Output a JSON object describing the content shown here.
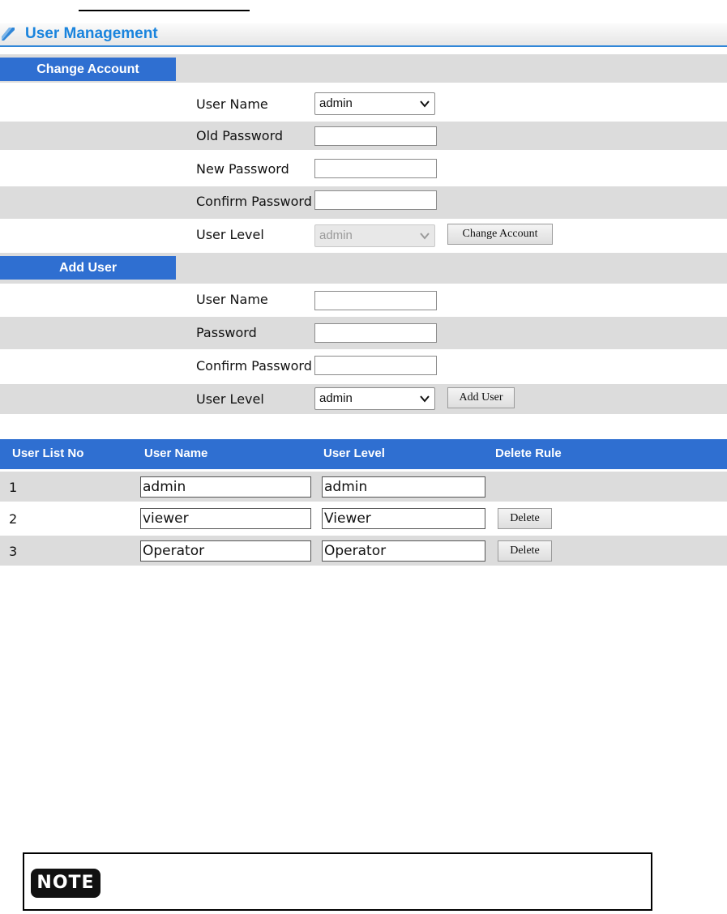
{
  "page": {
    "title": "User Management",
    "colors": {
      "accent": "#2f6fd1",
      "title": "#1a84dd",
      "row_gray": "#dcdcdc"
    }
  },
  "change_account": {
    "header": "Change Account",
    "user_name_label": "User Name",
    "user_name_value": "admin",
    "old_password_label": "Old Password",
    "new_password_label": "New Password",
    "confirm_password_label": "Confirm Password",
    "user_level_label": "User Level",
    "user_level_value": "admin",
    "button": "Change Account"
  },
  "add_user": {
    "header": "Add User",
    "user_name_label": "User Name",
    "password_label": "Password",
    "confirm_password_label": "Confirm Password",
    "user_level_label": "User Level",
    "user_level_value": "admin",
    "button": "Add User"
  },
  "user_list": {
    "columns": [
      "User List No",
      "User Name",
      "User Level",
      "Delete Rule"
    ],
    "rows": [
      {
        "no": "1",
        "name": "admin",
        "level": "admin",
        "delete": ""
      },
      {
        "no": "2",
        "name": "viewer",
        "level": "Viewer",
        "delete": "Delete"
      },
      {
        "no": "3",
        "name": "Operator",
        "level": "Operator",
        "delete": "Delete"
      }
    ]
  },
  "note": {
    "badge": "NOTE",
    "icon": "note-badge-icon"
  }
}
